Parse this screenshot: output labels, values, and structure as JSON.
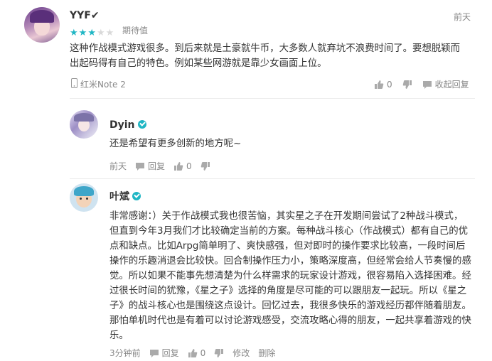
{
  "post": {
    "username": "YYF✔",
    "time": "前天",
    "rating_value": 3,
    "rating_max": 5,
    "rating_label": "期待值",
    "content": "这种作战模式游戏很多。到后来就是土豪就牛币，大多数人就弃坑不浪费时间了。要想脱颖而出起码得有自己的特色。例如某些网游就是靠少女画面上位。",
    "device": "红米Note 2",
    "like_count": "0",
    "collapse_label": "收起回复"
  },
  "replies": [
    {
      "username": "Dyin",
      "content": "还是希望有更多创新的地方呢~",
      "time": "前天",
      "reply_label": "回复",
      "like_count": "0"
    },
    {
      "username": "叶斌",
      "content": "非常感谢：）关于作战模式我也很苦恼，其实星之子在开发期间尝试了2种战斗模式，但直到今年3月我们才比较确定当前的方案。每种战斗核心（作战模式）都有自己的优点和缺点。比如Arpg简单明了、爽快感强，但对即时的操作要求比较高，一段时间后操作的乐趣消退会比较快。回合制操作压力小，策略深度高，但经常会给人节奏慢的感觉。所以如果不能事先想清楚为什么样需求的玩家设计游戏，很容易陷入选择困难。经过很长时间的犹豫，《星之子》选择的角度是尽可能的可以跟朋友一起玩。所以《星之子》的战斗核心也是围绕这点设计。回忆过去，我很多快乐的游戏经历都伴随着朋友。那怕单机时代也是有着可以讨论游戏感受，交流攻略心得的朋友，一起共享着游戏的快乐。",
      "time": "3分钟前",
      "reply_label": "回复",
      "like_count": "0",
      "edit_label": "修改",
      "delete_label": "删除"
    }
  ],
  "colors": {
    "accent": "#1fb6c4",
    "star_on": "#1fb6c4",
    "star_off": "#d9d9d9",
    "meta": "#888888"
  }
}
